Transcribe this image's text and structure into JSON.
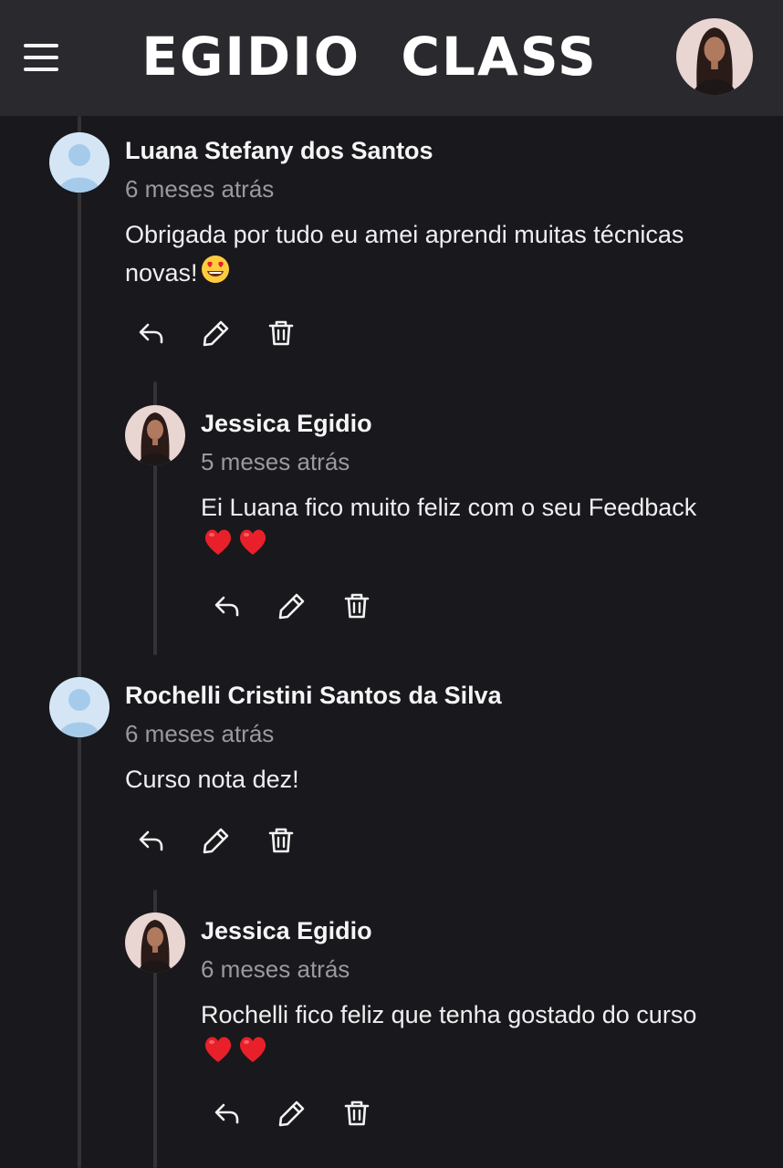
{
  "header": {
    "brand": "EGIDIO  CLASS",
    "menu_icon": "hamburger-menu-icon",
    "profile_icon": "user-photo-avatar"
  },
  "comments": [
    {
      "author": "Luana Stefany dos Santos",
      "time": "6 meses atrás",
      "text": "Obrigada por tudo eu amei aprendi muitas técnicas novas!",
      "emoji": "heart-eyes-emoji",
      "avatar": "default-user-avatar",
      "reply": {
        "author": "Jessica Egidio",
        "time": "5 meses atrás",
        "text": "Ei Luana fico muito feliz com o seu Feedback",
        "emoji": "two-red-hearts",
        "avatar": "jessica-photo-avatar"
      }
    },
    {
      "author": "Rochelli Cristini Santos da Silva",
      "time": "6 meses atrás",
      "text": "Curso nota dez!",
      "avatar": "default-user-avatar",
      "reply": {
        "author": "Jessica Egidio",
        "time": "6 meses atrás",
        "text": "Rochelli fico feliz que tenha gostado do curso",
        "emoji": "two-red-hearts",
        "avatar": "jessica-photo-avatar"
      }
    }
  ],
  "actions": [
    "reply-icon",
    "edit-pencil-icon",
    "trash-icon"
  ],
  "colors": {
    "background": "#19181c",
    "header": "#2a292d",
    "muted_text": "#9a999f",
    "default_avatar": "#cfe3f5",
    "heart": "#e8202a"
  }
}
